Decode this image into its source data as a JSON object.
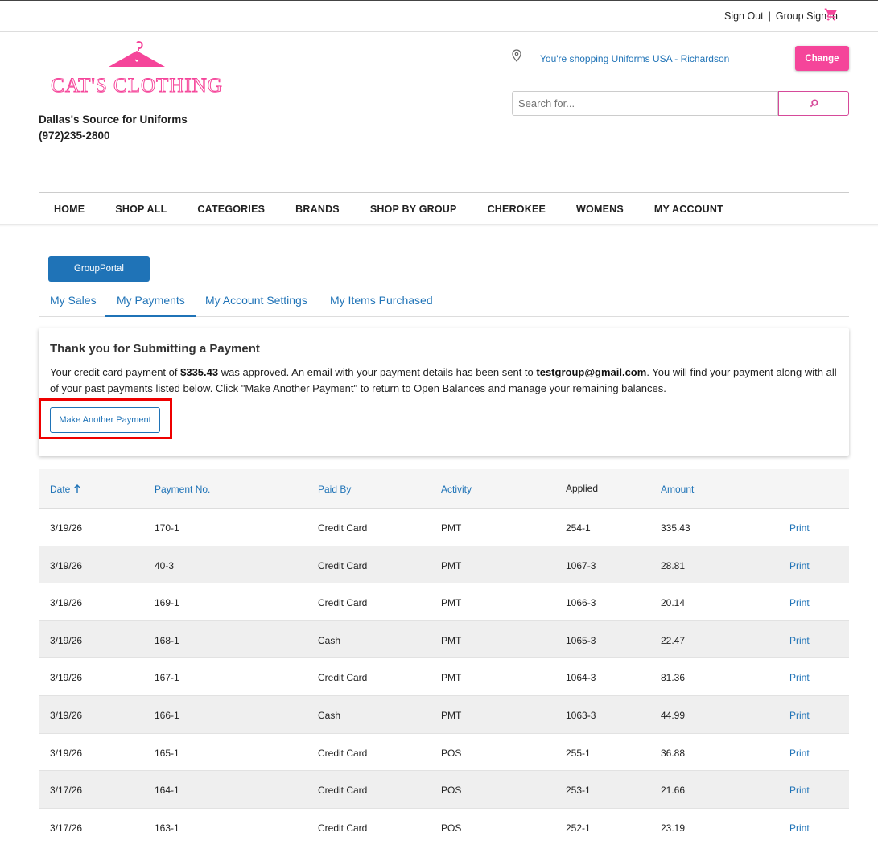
{
  "top_links": {
    "sign_out": "Sign Out",
    "separator": "|",
    "group_sign_in": "Group Sign In"
  },
  "brand": {
    "logo_text": "CAT'S CLOTHING",
    "tagline": "Dallas's Source for Uniforms",
    "phone": "(972)235-2800",
    "pink": "#f5459a"
  },
  "location": {
    "text": "You're shopping Uniforms USA - Richardson",
    "change_label": "Change"
  },
  "search": {
    "placeholder": "Search for..."
  },
  "nav": [
    "HOME",
    "SHOP ALL",
    "CATEGORIES",
    "BRANDS",
    "SHOP BY GROUP",
    "CHEROKEE",
    "WOMENS",
    "MY ACCOUNT"
  ],
  "portal_button": "GroupPortal",
  "tabs": [
    {
      "label": "My Sales",
      "active": false
    },
    {
      "label": "My Payments",
      "active": true
    },
    {
      "label": "My Account Settings",
      "active": false
    },
    {
      "label": "My Items Purchased",
      "active": false
    }
  ],
  "confirmation": {
    "title": "Thank you for Submitting a Payment",
    "msg_pre": "Your credit card payment of ",
    "amount": "$335.43",
    "msg_mid": " was approved. An email with your payment details has been sent to ",
    "email": "testgroup@gmail.com",
    "msg_post": ". You will find your payment along with all of your past payments listed below. Click \"Make Another Payment\" to return to Open Balances and manage your remaining balances.",
    "button_label": "Make Another Payment"
  },
  "table": {
    "headers": [
      "Date",
      "Payment No.",
      "Paid By",
      "Activity",
      "Applied",
      "Amount"
    ],
    "rows": [
      [
        "3/19/26",
        "170-1",
        "Credit Card",
        "PMT",
        "254-1",
        "335.43",
        "Print"
      ],
      [
        "3/19/26",
        "40-3",
        "Credit Card",
        "PMT",
        "1067-3",
        "28.81",
        "Print"
      ],
      [
        "3/19/26",
        "169-1",
        "Credit Card",
        "PMT",
        "1066-3",
        "20.14",
        "Print"
      ],
      [
        "3/19/26",
        "168-1",
        "Cash",
        "PMT",
        "1065-3",
        "22.47",
        "Print"
      ],
      [
        "3/19/26",
        "167-1",
        "Credit Card",
        "PMT",
        "1064-3",
        "81.36",
        "Print"
      ],
      [
        "3/19/26",
        "166-1",
        "Cash",
        "PMT",
        "1063-3",
        "44.99",
        "Print"
      ],
      [
        "3/19/26",
        "165-1",
        "Credit Card",
        "POS",
        "255-1",
        "36.88",
        "Print"
      ],
      [
        "3/17/26",
        "164-1",
        "Credit Card",
        "POS",
        "253-1",
        "21.66",
        "Print"
      ],
      [
        "3/17/26",
        "163-1",
        "Credit Card",
        "POS",
        "252-1",
        "23.19",
        "Print"
      ]
    ]
  }
}
